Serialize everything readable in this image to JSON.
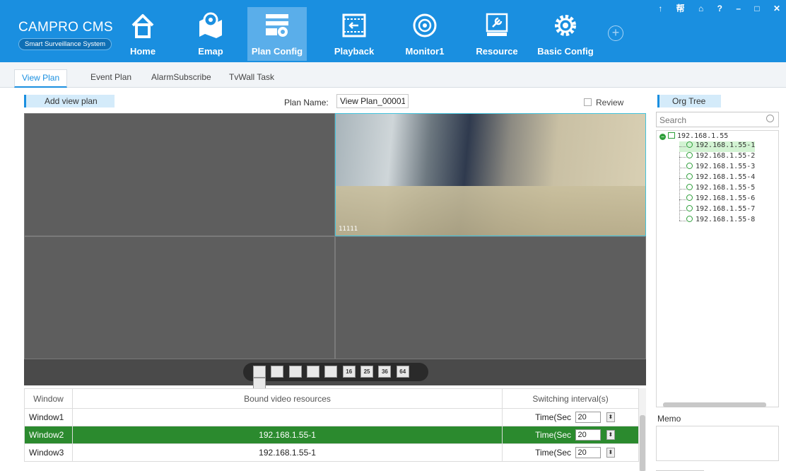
{
  "app": {
    "title": "CAMPRO CMS",
    "subtitle": "Smart Surveillance System"
  },
  "nav": {
    "items": [
      {
        "label": "Home",
        "icon": "home-icon"
      },
      {
        "label": "Emap",
        "icon": "map-pin-icon"
      },
      {
        "label": "Plan Config",
        "icon": "plan-config-icon",
        "active": true
      },
      {
        "label": "Playback",
        "icon": "playback-icon"
      },
      {
        "label": "Monitor1",
        "icon": "monitor-icon"
      },
      {
        "label": "Resource",
        "icon": "resource-icon"
      },
      {
        "label": "Basic Config",
        "icon": "gear-icon"
      }
    ],
    "add_label": "+"
  },
  "window_controls": [
    "↑",
    "帮",
    "⌂",
    "?",
    "–",
    "□",
    "✕"
  ],
  "tabs": [
    {
      "label": "View Plan",
      "active": true
    },
    {
      "label": "Event Plan"
    },
    {
      "label": "AlarmSubscribe"
    },
    {
      "label": "TvWall Task"
    }
  ],
  "plan": {
    "add_button": "Add view plan",
    "name_label": "Plan Name:",
    "name_value": "View Plan_00001",
    "review_label": "Review"
  },
  "video": {
    "osd_text": "11111",
    "layout_buttons": [
      "",
      "",
      "",
      "",
      "",
      "16",
      "25",
      "36",
      "64",
      ""
    ]
  },
  "table": {
    "headers": [
      "Window",
      "Bound video resources",
      "Switching interval(s)"
    ],
    "rows": [
      {
        "window": "Window1",
        "resource": "",
        "interval_label": "Time(Sec",
        "interval": "20"
      },
      {
        "window": "Window2",
        "resource": "192.168.1.55-1",
        "interval_label": "Time(Sec",
        "interval": "20",
        "selected": true
      },
      {
        "window": "Window3",
        "resource": "192.168.1.55-1",
        "interval_label": "Time(Sec",
        "interval": "20"
      }
    ]
  },
  "org_tree": {
    "button": "Org Tree",
    "search_placeholder": "Search",
    "root": "192.168.1.55",
    "channels": [
      "192.168.1.55-1",
      "192.168.1.55-2",
      "192.168.1.55-3",
      "192.168.1.55-4",
      "192.168.1.55-5",
      "192.168.1.55-6",
      "192.168.1.55-7",
      "192.168.1.55-8"
    ],
    "selected_channel": "192.168.1.55-1"
  },
  "memo": {
    "label": "Memo"
  },
  "colors": {
    "header": "#1a8fe0",
    "active_nav": "#5aaeea",
    "selected_row": "#2b8a2e",
    "tree_icon": "#2e9f3a"
  }
}
